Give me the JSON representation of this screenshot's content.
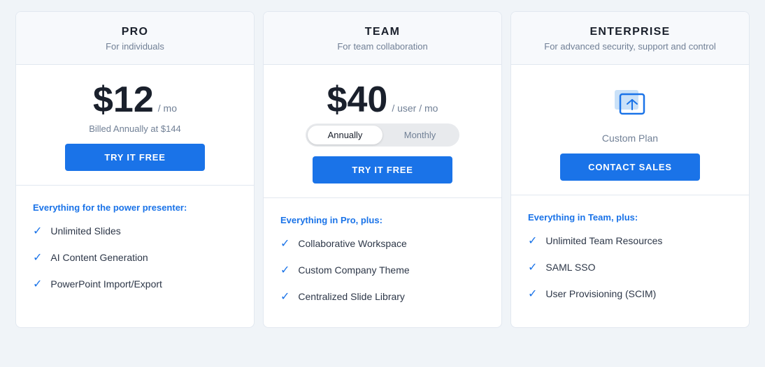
{
  "plans": [
    {
      "id": "pro",
      "name": "PRO",
      "tagline": "For individuals",
      "price": "$12",
      "price_period": "/ mo",
      "billed_note": "Billed Annually at $144",
      "cta_label": "TRY IT FREE",
      "cta_type": "try",
      "features_heading": "Everything for the power presenter:",
      "features": [
        "Unlimited Slides",
        "AI Content Generation",
        "PowerPoint Import/Export"
      ]
    },
    {
      "id": "team",
      "name": "TEAM",
      "tagline": "For team collaboration",
      "price": "$40",
      "price_period": "/ user / mo",
      "billed_note": "",
      "cta_label": "TRY IT FREE",
      "cta_type": "try",
      "toggle": {
        "option1": "Annually",
        "option2": "Monthly",
        "active": "Annually"
      },
      "features_heading": "Everything in Pro, plus:",
      "features": [
        "Collaborative Workspace",
        "Custom Company Theme",
        "Centralized Slide Library"
      ]
    },
    {
      "id": "enterprise",
      "name": "ENTERPRISE",
      "tagline": "For advanced security, support and control",
      "price": null,
      "price_period": null,
      "billed_note": null,
      "cta_label": "CONTACT SALES",
      "cta_type": "contact",
      "custom_plan_label": "Custom Plan",
      "features_heading": "Everything in Team, plus:",
      "features": [
        "Unlimited Team Resources",
        "SAML SSO",
        "User Provisioning (SCIM)"
      ]
    }
  ]
}
